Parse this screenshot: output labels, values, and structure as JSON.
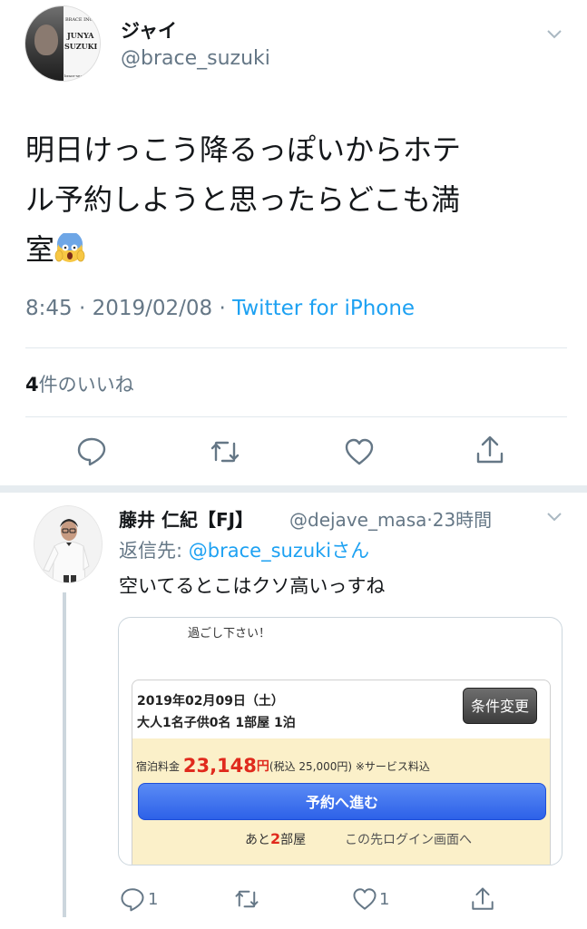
{
  "main_tweet": {
    "avatar": {
      "brand": "BRACE INC.",
      "first_name": "JUNYA",
      "last_name": "SUZUKI",
      "url": "brace-suzuki.com"
    },
    "display_name": "ジャイ",
    "handle": "@brace_suzuki",
    "text_lines": [
      "明日けっこう降るっぽいからホテ",
      "ル予約しようと思ったらどこも満",
      "室"
    ],
    "emoji": "screaming-face-emoji",
    "time": "8:45",
    "date": "2019/02/08",
    "separator": "·",
    "source": "Twitter for iPhone",
    "likes": {
      "count": "4",
      "label": "件のいいね"
    },
    "actions": [
      "reply-icon",
      "retweet-icon",
      "like-icon",
      "share-icon"
    ]
  },
  "reply_tweet": {
    "display_name": "藤井 仁紀【FJ】",
    "handle": "@dejave_masa",
    "separator": "·",
    "time_ago": "23時間",
    "replying_prefix": "返信先:",
    "replying_mention": "@brace_suzuki",
    "replying_suffix": "さん",
    "text": "空いてるとこはクソ高いっすね",
    "media": {
      "header": "過ごし下さい！",
      "date_line": "2019年02月09日（土）",
      "guests_line": "大人1名子供0名 1部屋 1泊",
      "change_button": "条件変更",
      "price_label": "宿泊料金",
      "price": "23,148",
      "yen": "円",
      "tax_note": "(税込 25,000円) ※サービス料込",
      "book_button": "予約へ進む",
      "rooms_prefix": "あと",
      "rooms_count": "2",
      "rooms_suffix": "部屋",
      "login_note": "この先ログイン画面へ"
    },
    "reply_count": "1",
    "like_count": "1"
  },
  "colors": {
    "accent": "#1da1f2",
    "muted": "#657786",
    "divider": "#e1e8ed",
    "price_red": "#e02a1d"
  }
}
